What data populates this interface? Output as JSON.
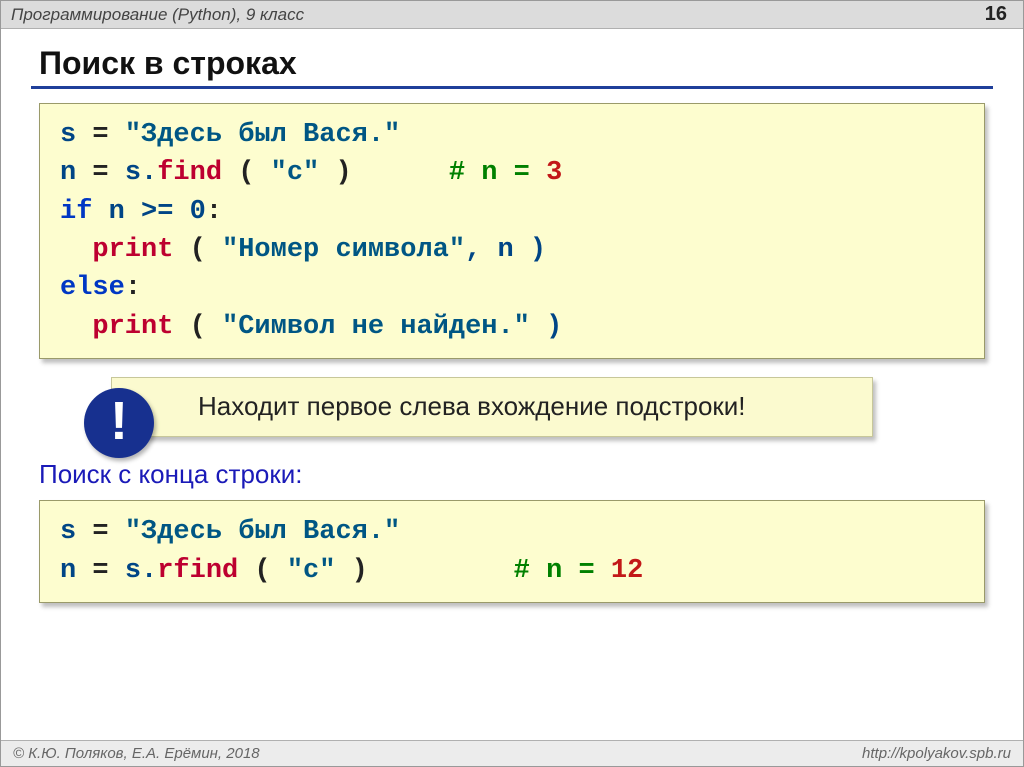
{
  "header": {
    "course": "Программирование (Python), 9 класс",
    "page": "16"
  },
  "title": "Поиск в строках",
  "code1": {
    "l1_var": "s",
    "l1_eq": " = ",
    "l1_str": "\"Здесь был Вася.\"",
    "l2_var": "n",
    "l2_eq": " = ",
    "l2_obj": "s.",
    "l2_fn": "find",
    "l2_arg_open": " ( ",
    "l2_arg": "\"с\"",
    "l2_arg_close": " )",
    "l2_cmt": "      # n = ",
    "l2_num": "3",
    "l3_if": "if",
    "l3_cond": " n >= ",
    "l3_zero": "0",
    "l3_colon": ":",
    "l4_indent": "  ",
    "l4_print": "print",
    "l4_open": " ( ",
    "l4_str": "\"Номер символа\"",
    "l4_rest": ", n )",
    "l5_else": "else",
    "l5_colon": ":",
    "l6_indent": "  ",
    "l6_print": "print",
    "l6_open": " ( ",
    "l6_str": "\"Символ не найден.\"",
    "l6_close": " )"
  },
  "tip": "Находит первое слева вхождение подстроки!",
  "sub": "Поиск с конца строки:",
  "code2": {
    "l1_var": "s",
    "l1_eq": " = ",
    "l1_str": "\"Здесь был Вася.\"",
    "l2_var": "n",
    "l2_eq": " = ",
    "l2_obj": "s.",
    "l2_fn": "rfind",
    "l2_open": " ( ",
    "l2_arg": "\"с\"",
    "l2_close": " )",
    "l2_cmt": "         # n = ",
    "l2_num": "12"
  },
  "footer": {
    "left": "© К.Ю. Поляков, Е.А. Ерёмин, 2018",
    "right": "http://kpolyakov.spb.ru"
  }
}
